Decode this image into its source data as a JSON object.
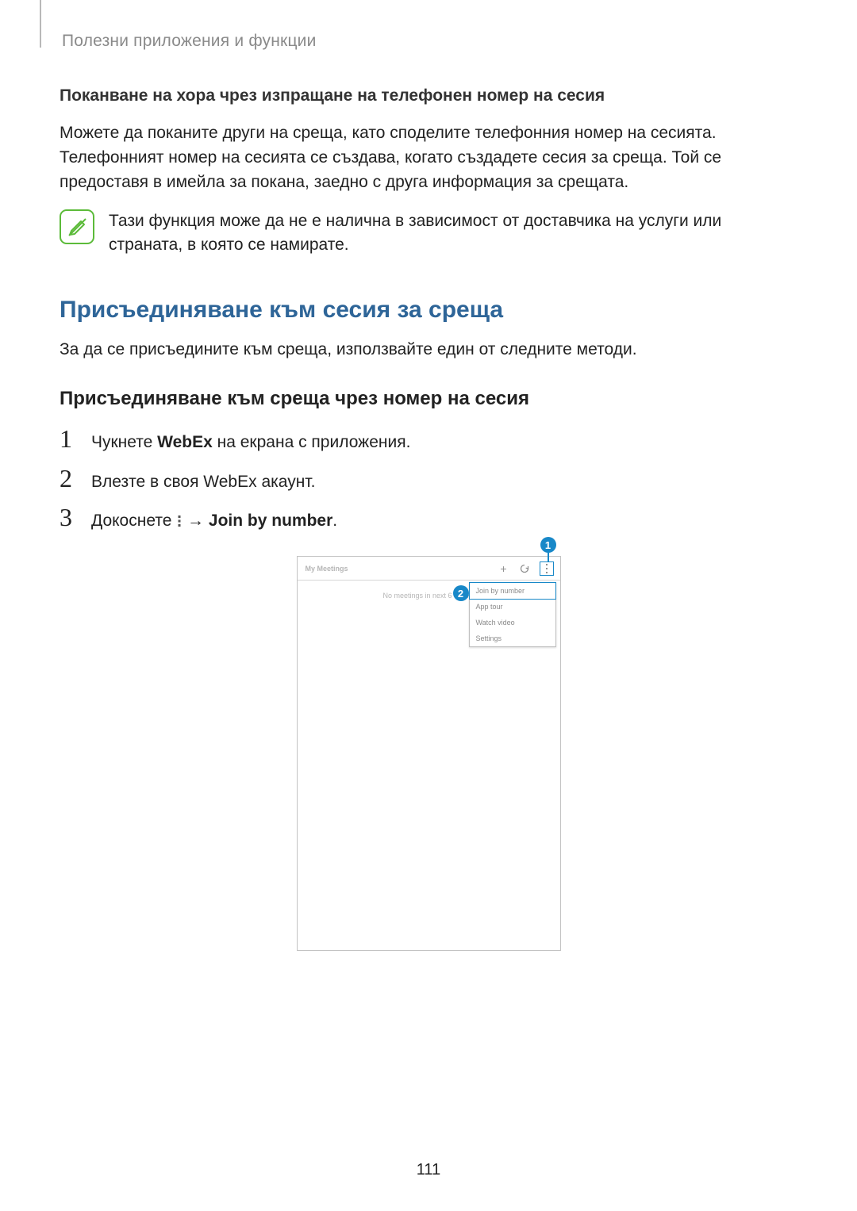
{
  "header": "Полезни приложения и функции",
  "section1": {
    "heading": "Поканване на хора чрез изпращане на телефонен номер на сесия",
    "body": "Можете да поканите други на среща, като споделите телефонния номер на сесията. Телефонният номер на сесията се създава, когато създадете сесия за среща. Той се предоставя в имейла за покана, заедно с друга информация за срещата.",
    "note": "Тази функция може да не е налична в зависимост от доставчика на услуги или страната, в която се намирате."
  },
  "section2": {
    "title": "Присъединяване към сесия за среща",
    "intro": "За да се присъедините към среща, използвайте един от следните методи.",
    "subhead": "Присъединяване към среща чрез номер на сесия",
    "steps": {
      "s1": {
        "num": "1",
        "prefix": "Чукнете ",
        "bold": "WebEx",
        "suffix": " на екрана с приложения."
      },
      "s2": {
        "num": "2",
        "text": "Влезте в своя WebEx акаунт."
      },
      "s3": {
        "num": "3",
        "prefix": "Докоснете ",
        "arrow": " → ",
        "bold": "Join by number",
        "suffix": "."
      }
    }
  },
  "screenshot": {
    "title": "My Meetings",
    "empty": "No meetings in next 6 weeks",
    "menu": {
      "i1": "Join by number",
      "i2": "App tour",
      "i3": "Watch video",
      "i4": "Settings"
    },
    "callouts": {
      "c1": "1",
      "c2": "2"
    }
  },
  "pageNumber": "111"
}
